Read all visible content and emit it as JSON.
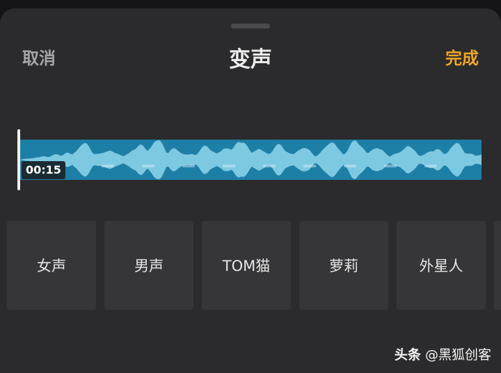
{
  "header": {
    "cancel_label": "取消",
    "title": "变声",
    "done_label": "完成"
  },
  "timeline": {
    "current_time": "00:15"
  },
  "effects": [
    {
      "label": "女声"
    },
    {
      "label": "男声"
    },
    {
      "label": "TOM猫"
    },
    {
      "label": "萝莉"
    },
    {
      "label": "外星人"
    },
    {
      "label": ""
    }
  ],
  "watermark": {
    "brand": "头条",
    "handle": "@黑狐创客"
  },
  "colors": {
    "accent": "#f0a52a",
    "waveform_bg": "#1e7fa6",
    "waveform_fill": "#8fd6ec"
  }
}
